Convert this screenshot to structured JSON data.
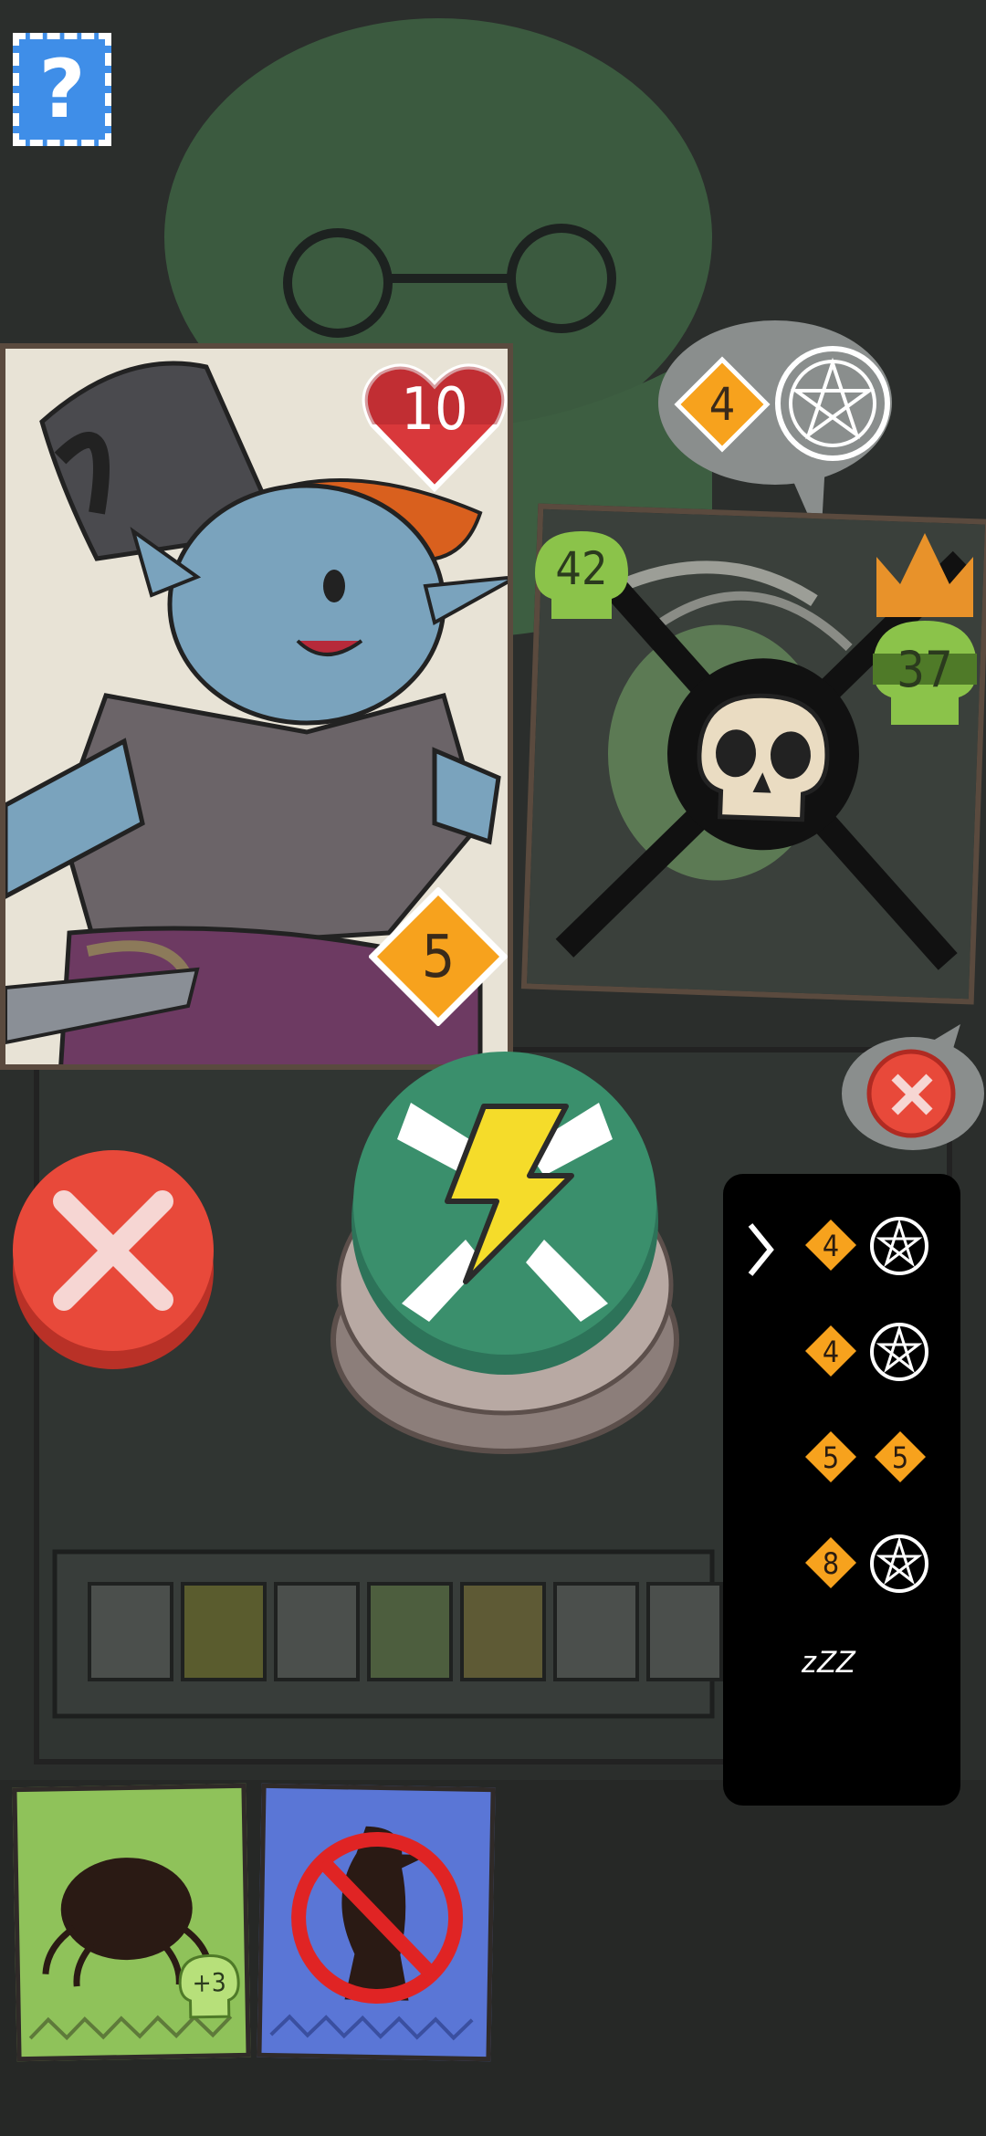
{
  "help_button": {
    "label": "?"
  },
  "player_card": {
    "health": "10",
    "attack": "5",
    "character": "witch"
  },
  "enemy_intent": {
    "value": "4",
    "icon": "pentagram-icon"
  },
  "enemy_card": {
    "left_skull": "42",
    "right_skull": "37",
    "state": "defeated"
  },
  "moves_list": [
    {
      "a": "4",
      "b_icon": "pentagram-icon",
      "selected": true
    },
    {
      "a": "4",
      "b_icon": "pentagram-icon",
      "selected": false
    },
    {
      "a": "5",
      "b": "5",
      "selected": false
    },
    {
      "a": "8",
      "b_icon": "pentagram-icon",
      "selected": false
    },
    {
      "sleep": "zZZ"
    }
  ],
  "hand": [
    {
      "name": "spider-card",
      "bonus": "+3",
      "color": "#8fc25a"
    },
    {
      "name": "no-bird-card",
      "color": "#5a76d6"
    }
  ],
  "colors": {
    "cancel_red": "#e8493a",
    "attack_green": "#3a8f6c",
    "diamond_orange": "#f7a21d",
    "heart_red": "#d9383b",
    "skull_green": "#8bc34a",
    "crown_orange": "#e8922a"
  }
}
